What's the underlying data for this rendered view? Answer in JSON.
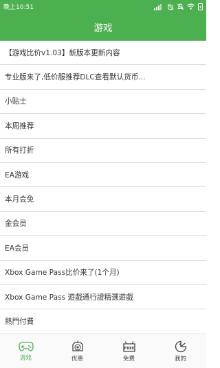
{
  "status": {
    "time": "晚上10:51",
    "battery_icon": "battery-charging-icon"
  },
  "header": {
    "title": "游戏"
  },
  "list": {
    "items": [
      "【游戏比价v1.03】新版本更新内容",
      "专业版来了,低价服推荐DLC查看默认货币...",
      "小贴士",
      "本周推荐",
      "所有打折",
      "EA游戏",
      "本月会免",
      "金会员",
      "EA会员",
      "Xbox Game Pass比价来了(1个月)",
      "Xbox Game Pass 遊戲通行證精選遊戲",
      "熱門付費"
    ]
  },
  "tabbar": {
    "tabs": [
      {
        "label": "游戏",
        "icon": "gamepad-icon",
        "active": true
      },
      {
        "label": "优惠",
        "icon": "coupon-icon",
        "active": false
      },
      {
        "label": "免费",
        "icon": "free-tag-icon",
        "active": false
      },
      {
        "label": "我的",
        "icon": "profile-icon",
        "active": false
      }
    ],
    "active_color": "#4caf50"
  },
  "colors": {
    "primary": "#4caf50",
    "divider": "#dcdcdc"
  }
}
